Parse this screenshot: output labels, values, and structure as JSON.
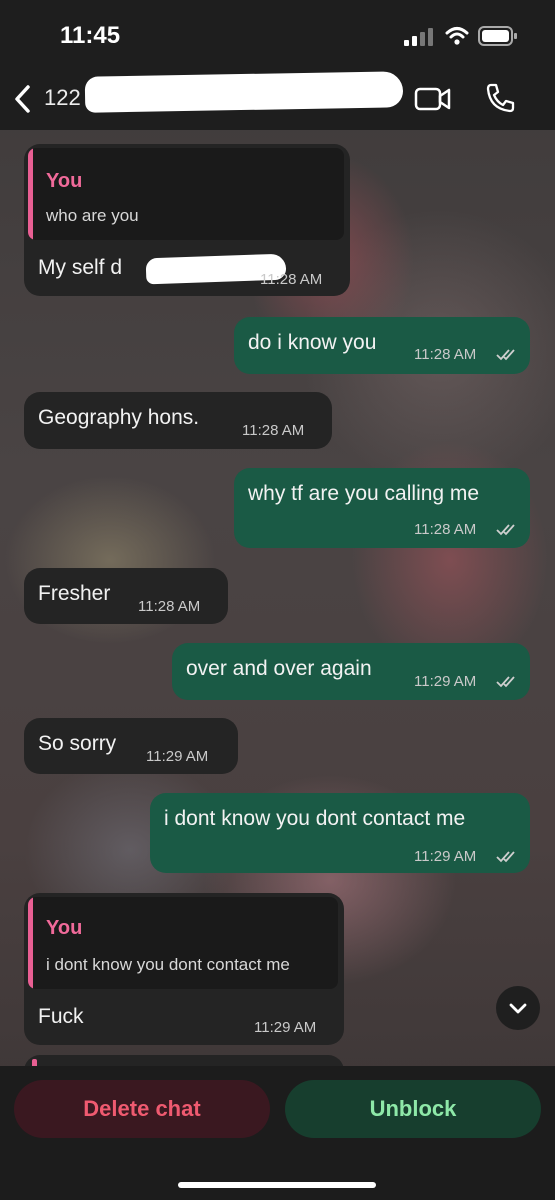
{
  "status_bar": {
    "time": "11:45"
  },
  "header": {
    "contact_prefix": "122"
  },
  "messages": [
    {
      "direction": "in",
      "quote_name": "You",
      "quote_text": "who are you",
      "text": "My self d",
      "time": "11:28 AM"
    },
    {
      "direction": "out",
      "text": "do i know you",
      "time": "11:28 AM"
    },
    {
      "direction": "in",
      "text": "Geography hons.",
      "time": "11:28 AM"
    },
    {
      "direction": "out",
      "text": "why tf are you calling me",
      "time": "11:28 AM"
    },
    {
      "direction": "in",
      "text": "Fresher",
      "time": "11:28 AM"
    },
    {
      "direction": "out",
      "text": "over and over again",
      "time": "11:29 AM"
    },
    {
      "direction": "in",
      "text": "So sorry",
      "time": "11:29 AM"
    },
    {
      "direction": "out",
      "text": "i dont know you dont contact me",
      "time": "11:29 AM"
    },
    {
      "direction": "in",
      "quote_name": "You",
      "quote_text": "i dont know you dont contact me",
      "text": "Fuck",
      "time": "11:29 AM"
    }
  ],
  "actions": {
    "delete_label": "Delete chat",
    "unblock_label": "Unblock"
  },
  "colors": {
    "outgoing_bubble": "#1a5a45",
    "incoming_bubble": "#242424",
    "quote_accent": "#e95f93",
    "delete": "#ef5a70",
    "unblock": "#8ee8a8"
  }
}
